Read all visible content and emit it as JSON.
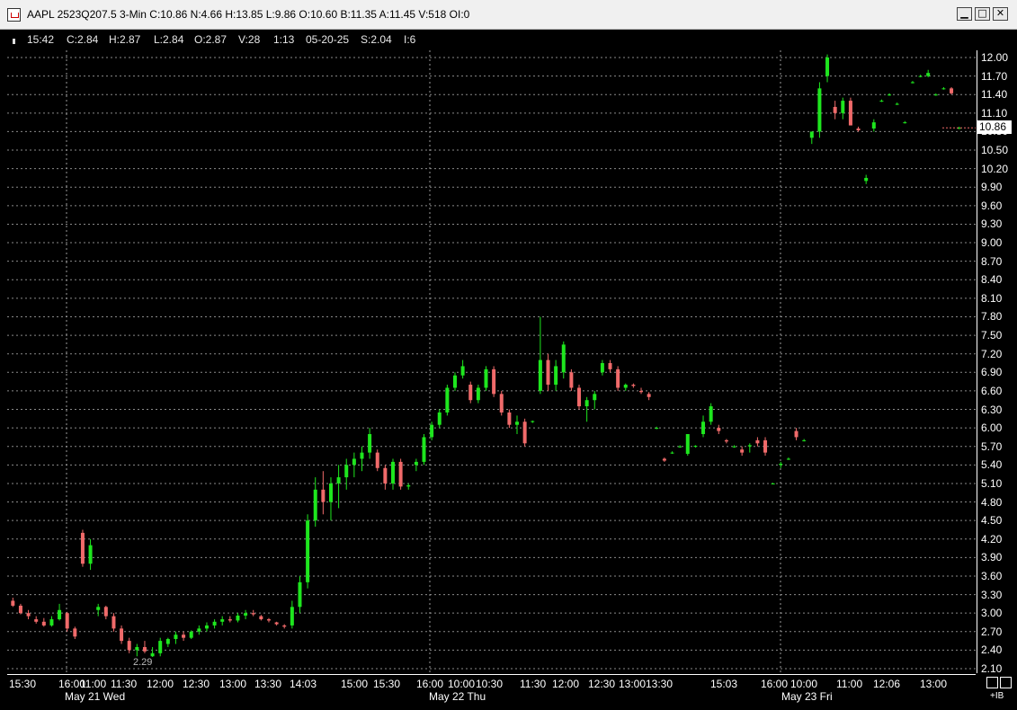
{
  "window": {
    "title": "AAPL 2523Q207.5 3-Min C:10.86 N:4.66 H:13.85 L:9.86 O:10.60 B:11.35 A:11.45 V:518 OI:0",
    "minimize": "▁",
    "maximize": "□",
    "close": "✕"
  },
  "info": [
    "15:42",
    "C:2.84",
    "H:2.87",
    "L:2.84",
    "O:2.87",
    "V:28",
    "1:13",
    "05-20-25",
    "S:2.04",
    "I:6"
  ],
  "price_axis": {
    "labels": [
      "12.00",
      "11.70",
      "11.40",
      "11.10",
      "10.80",
      "10.50",
      "10.20",
      "9.90",
      "9.60",
      "9.30",
      "9.00",
      "8.70",
      "8.40",
      "8.10",
      "7.80",
      "7.50",
      "7.20",
      "6.90",
      "6.60",
      "6.30",
      "6.00",
      "5.70",
      "5.40",
      "5.10",
      "4.80",
      "4.50",
      "4.20",
      "3.90",
      "3.60",
      "3.30",
      "3.00",
      "2.70",
      "2.40",
      "2.10"
    ],
    "last_price": "10.86"
  },
  "time_axis": {
    "labels": [
      "15:30",
      "16:00",
      "11:00",
      "11:30",
      "12:00",
      "12:30",
      "13:00",
      "13:30",
      "14:03",
      "15:00",
      "15:30",
      "16:00",
      "10:00",
      "10:30",
      "11:30",
      "12:00",
      "12:30",
      "13:00",
      "13:30",
      "15:03",
      "16:00",
      "10:00",
      "11:00",
      "12:06",
      "13:00"
    ],
    "dates": [
      "May 21 Wed",
      "May 22 Thu",
      "May 23 Fri"
    ]
  },
  "low_marker": "2.29",
  "corner_label": "+IB",
  "chart_data": {
    "type": "candlestick",
    "ylim": [
      2.1,
      12.0
    ],
    "candles": [
      [
        3.2,
        3.25,
        3.1,
        3.12
      ],
      [
        3.12,
        3.15,
        2.98,
        3.0
      ],
      [
        3.0,
        3.05,
        2.9,
        2.95
      ],
      [
        2.9,
        2.95,
        2.83,
        2.86
      ],
      [
        2.86,
        2.92,
        2.78,
        2.8
      ],
      [
        2.8,
        2.95,
        2.78,
        2.9
      ],
      [
        2.9,
        3.15,
        2.88,
        3.05
      ],
      [
        3.0,
        3.02,
        2.7,
        2.75
      ],
      [
        2.75,
        2.78,
        2.58,
        2.62
      ],
      [
        4.3,
        4.35,
        3.75,
        3.8
      ],
      [
        3.8,
        4.2,
        3.7,
        4.1
      ],
      [
        3.05,
        3.15,
        2.95,
        3.1
      ],
      [
        3.1,
        3.12,
        2.9,
        2.95
      ],
      [
        2.95,
        3.0,
        2.7,
        2.75
      ],
      [
        2.75,
        2.8,
        2.5,
        2.55
      ],
      [
        2.55,
        2.6,
        2.35,
        2.4
      ],
      [
        2.4,
        2.5,
        2.3,
        2.45
      ],
      [
        2.45,
        2.55,
        2.35,
        2.38
      ],
      [
        2.3,
        2.45,
        2.29,
        2.35
      ],
      [
        2.35,
        2.6,
        2.3,
        2.55
      ],
      [
        2.5,
        2.6,
        2.45,
        2.58
      ],
      [
        2.58,
        2.7,
        2.5,
        2.65
      ],
      [
        2.65,
        2.7,
        2.55,
        2.6
      ],
      [
        2.6,
        2.72,
        2.58,
        2.7
      ],
      [
        2.7,
        2.8,
        2.65,
        2.75
      ],
      [
        2.75,
        2.85,
        2.7,
        2.8
      ],
      [
        2.8,
        2.9,
        2.75,
        2.86
      ],
      [
        2.86,
        2.95,
        2.8,
        2.9
      ],
      [
        2.9,
        2.95,
        2.85,
        2.88
      ],
      [
        2.88,
        3.0,
        2.85,
        2.96
      ],
      [
        2.96,
        3.05,
        2.9,
        3.0
      ],
      [
        3.0,
        3.05,
        2.95,
        2.98
      ],
      [
        2.95,
        2.97,
        2.88,
        2.9
      ],
      [
        2.9,
        2.92,
        2.85,
        2.88
      ],
      [
        2.85,
        2.86,
        2.8,
        2.82
      ],
      [
        2.8,
        2.82,
        2.75,
        2.78
      ],
      [
        2.8,
        3.2,
        2.75,
        3.1
      ],
      [
        3.1,
        3.6,
        3.0,
        3.5
      ],
      [
        3.5,
        4.6,
        3.4,
        4.5
      ],
      [
        4.5,
        5.2,
        4.4,
        5.0
      ],
      [
        5.0,
        5.3,
        4.6,
        4.8
      ],
      [
        4.8,
        5.2,
        4.5,
        5.1
      ],
      [
        5.1,
        5.4,
        4.7,
        5.2
      ],
      [
        5.2,
        5.5,
        5.0,
        5.4
      ],
      [
        5.4,
        5.6,
        5.2,
        5.5
      ],
      [
        5.5,
        5.7,
        5.3,
        5.6
      ],
      [
        5.6,
        6.0,
        5.5,
        5.9
      ],
      [
        5.6,
        5.65,
        5.3,
        5.35
      ],
      [
        5.35,
        5.4,
        5.0,
        5.1
      ],
      [
        5.1,
        5.5,
        5.0,
        5.45
      ],
      [
        5.45,
        5.5,
        5.0,
        5.05
      ],
      [
        5.05,
        5.1,
        5.0,
        5.07
      ],
      [
        5.4,
        5.5,
        5.3,
        5.45
      ],
      [
        5.45,
        5.9,
        5.4,
        5.85
      ],
      [
        5.85,
        6.1,
        5.8,
        6.05
      ],
      [
        6.05,
        6.3,
        6.0,
        6.25
      ],
      [
        6.25,
        6.7,
        6.2,
        6.65
      ],
      [
        6.65,
        6.9,
        6.6,
        6.85
      ],
      [
        6.85,
        7.1,
        6.8,
        7.0
      ],
      [
        6.7,
        6.75,
        6.4,
        6.45
      ],
      [
        6.45,
        6.7,
        6.4,
        6.65
      ],
      [
        6.65,
        7.0,
        6.6,
        6.95
      ],
      [
        6.95,
        7.0,
        6.5,
        6.55
      ],
      [
        6.55,
        6.6,
        6.2,
        6.25
      ],
      [
        6.25,
        6.3,
        6.0,
        6.05
      ],
      [
        6.05,
        6.2,
        5.9,
        6.1
      ],
      [
        6.1,
        6.15,
        5.7,
        5.75
      ],
      [
        6.1,
        6.12,
        6.08,
        6.11
      ],
      [
        6.6,
        7.8,
        6.55,
        7.1
      ],
      [
        7.1,
        7.2,
        6.6,
        6.7
      ],
      [
        6.7,
        7.1,
        6.6,
        7.0
      ],
      [
        6.9,
        7.4,
        6.8,
        7.35
      ],
      [
        6.9,
        6.95,
        6.6,
        6.65
      ],
      [
        6.65,
        6.7,
        6.3,
        6.35
      ],
      [
        6.35,
        6.5,
        6.1,
        6.45
      ],
      [
        6.45,
        6.6,
        6.3,
        6.55
      ],
      [
        6.9,
        7.1,
        6.85,
        7.05
      ],
      [
        7.05,
        7.1,
        6.9,
        6.95
      ],
      [
        6.95,
        7.0,
        6.6,
        6.65
      ],
      [
        6.65,
        6.72,
        6.6,
        6.7
      ],
      [
        6.7,
        6.72,
        6.65,
        6.68
      ],
      [
        6.6,
        6.65,
        6.55,
        6.58
      ],
      [
        6.55,
        6.58,
        6.45,
        6.5
      ],
      [
        6.0,
        6.02,
        5.98,
        6.0
      ],
      [
        5.5,
        5.52,
        5.45,
        5.47
      ],
      [
        5.6,
        5.62,
        5.58,
        5.6
      ],
      [
        5.7,
        5.72,
        5.68,
        5.7
      ],
      [
        5.58,
        5.9,
        5.55,
        5.9
      ],
      [
        5.7,
        5.72,
        5.68,
        5.71
      ],
      [
        5.9,
        6.2,
        5.85,
        6.1
      ],
      [
        6.1,
        6.4,
        6.05,
        6.35
      ],
      [
        6.0,
        6.05,
        5.9,
        5.95
      ],
      [
        5.8,
        5.82,
        5.75,
        5.78
      ],
      [
        5.7,
        5.72,
        5.68,
        5.7
      ],
      [
        5.65,
        5.7,
        5.55,
        5.6
      ],
      [
        5.7,
        5.75,
        5.6,
        5.72
      ],
      [
        5.8,
        5.85,
        5.7,
        5.75
      ],
      [
        5.8,
        5.85,
        5.55,
        5.6
      ],
      [
        5.1,
        5.11,
        5.09,
        5.1
      ],
      [
        5.4,
        5.45,
        5.35,
        5.42
      ],
      [
        5.5,
        5.52,
        5.48,
        5.5
      ],
      [
        5.95,
        6.0,
        5.8,
        5.85
      ],
      [
        5.8,
        5.82,
        5.78,
        5.8
      ],
      [
        10.7,
        10.8,
        10.6,
        10.8
      ],
      [
        10.8,
        11.6,
        10.7,
        11.5
      ],
      [
        11.7,
        12.05,
        11.6,
        12.0
      ],
      [
        11.2,
        11.3,
        11.0,
        11.1
      ],
      [
        11.1,
        11.35,
        11.0,
        11.3
      ],
      [
        11.3,
        11.35,
        10.9,
        10.9
      ],
      [
        10.85,
        10.88,
        10.8,
        10.82
      ],
      [
        10.0,
        10.1,
        9.95,
        10.05
      ],
      [
        10.85,
        11.0,
        10.8,
        10.95
      ],
      [
        11.3,
        11.32,
        11.28,
        11.3
      ],
      [
        11.4,
        11.42,
        11.38,
        11.4
      ],
      [
        11.25,
        11.27,
        11.23,
        11.25
      ],
      [
        10.95,
        10.97,
        10.93,
        10.95
      ],
      [
        11.6,
        11.62,
        11.58,
        11.6
      ],
      [
        11.7,
        11.72,
        11.68,
        11.7
      ],
      [
        11.7,
        11.8,
        11.68,
        11.75
      ],
      [
        11.4,
        11.42,
        11.38,
        11.4
      ],
      [
        11.5,
        11.52,
        11.48,
        11.5
      ],
      [
        11.5,
        11.52,
        11.4,
        11.42
      ],
      [
        10.86,
        10.88,
        10.84,
        10.86
      ]
    ]
  }
}
